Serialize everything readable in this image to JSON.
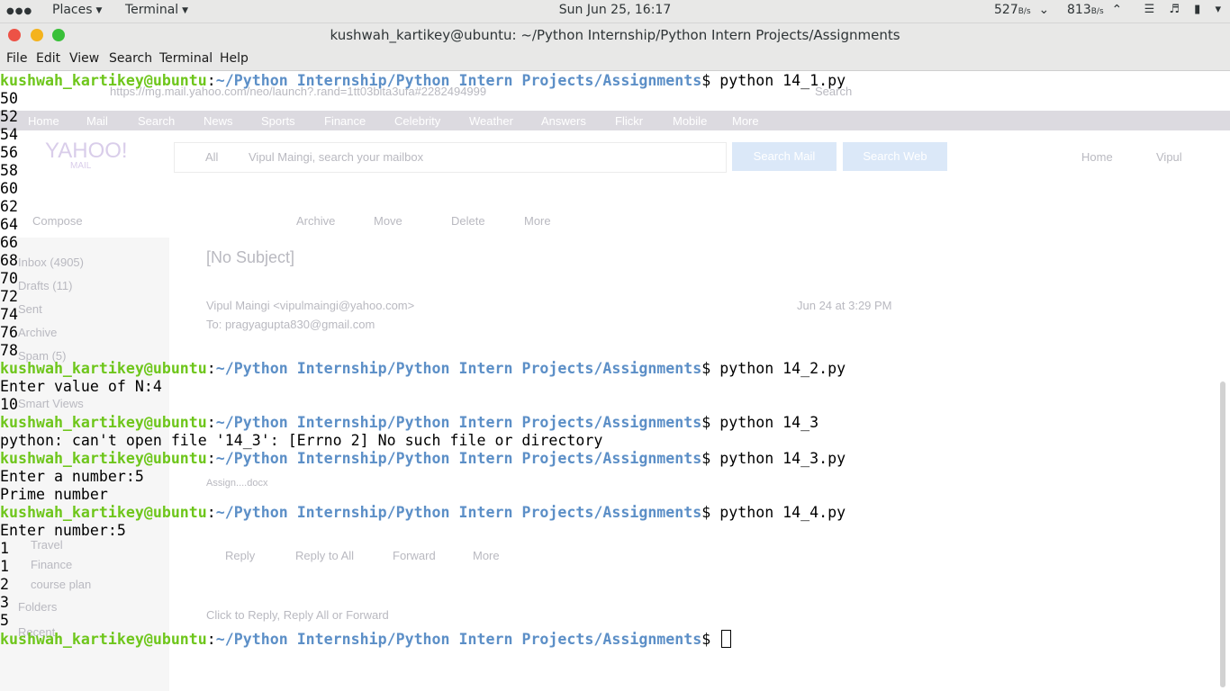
{
  "topbar": {
    "places": "Places",
    "terminal": "Terminal",
    "clock": "Sun Jun 25, 16:17",
    "net_down_value": "527",
    "net_up_value": "813",
    "net_unit": "B/s"
  },
  "window": {
    "title": "kushwah_kartikey@ubuntu: ~/Python Internship/Python Intern Projects/Assignments"
  },
  "menubar": {
    "file": "File",
    "edit": "Edit",
    "view": "View",
    "search": "Search",
    "terminal": "Terminal",
    "help": "Help"
  },
  "background_browser": {
    "url": "https://mg.mail.yahoo.com/neo/launch?.rand=1tt03bita3ufa#2282494999",
    "search_placeholder": "Search",
    "nav": [
      "Home",
      "Mail",
      "Search",
      "News",
      "Sports",
      "Finance",
      "Celebrity",
      "Weather",
      "Answers",
      "Flickr",
      "Mobile",
      "More"
    ],
    "logo": "YAHOO!",
    "logo_sub": "MAIL",
    "mailbox_search_scope": "All",
    "mailbox_search_placeholder": "Vipul Maingi, search your mailbox",
    "search_mail": "Search Mail",
    "search_web": "Search Web",
    "home": "Home",
    "user": "Vipul",
    "compose": "Compose",
    "toolbar": [
      "Archive",
      "Move",
      "Delete",
      "More"
    ],
    "subject": "[No Subject]",
    "sender": "Vipul Maingi",
    "sender_email": "<vipulmaingi@yahoo.com>",
    "date": "Jun 24 at 3:29 PM",
    "to": "To: pragyagupta830@gmail.com",
    "attachment": "Assign....docx",
    "actions": [
      "Reply",
      "Reply to All",
      "Forward",
      "More"
    ],
    "quick_reply": "Click to Reply, Reply All or Forward",
    "folders_top": [
      "Inbox (4905)",
      "Drafts (11)",
      "Sent",
      "Archive",
      "Spam (5)"
    ],
    "smart_views": "Smart Views",
    "folders_bottom": [
      "Travel",
      "Finance",
      "course plan"
    ],
    "folders_label": "Folders",
    "recent_label": "Recent"
  },
  "terminal": {
    "user": "kushwah_kartikey@ubuntu",
    "path": "~/Python Internship/Python Intern Projects/Assignments",
    "prompt_suffix": "$ ",
    "cmd1": "python 14_1.py",
    "out1": [
      "50",
      "52",
      "54",
      "56",
      "58",
      "60",
      "62",
      "64",
      "66",
      "68",
      "70",
      "72",
      "74",
      "76",
      "78"
    ],
    "cmd2": "python 14_2.py",
    "out2": [
      "Enter value of N:4",
      "10"
    ],
    "cmd3": "python 14_3",
    "out3": [
      "python: can't open file '14_3': [Errno 2] No such file or directory"
    ],
    "cmd4": "python 14_3.py",
    "out4": [
      "Enter a number:5",
      "Prime number"
    ],
    "cmd5": "python 14_4.py",
    "out5": [
      "Enter number:5",
      "1",
      "1",
      "2",
      "3",
      "5"
    ]
  }
}
